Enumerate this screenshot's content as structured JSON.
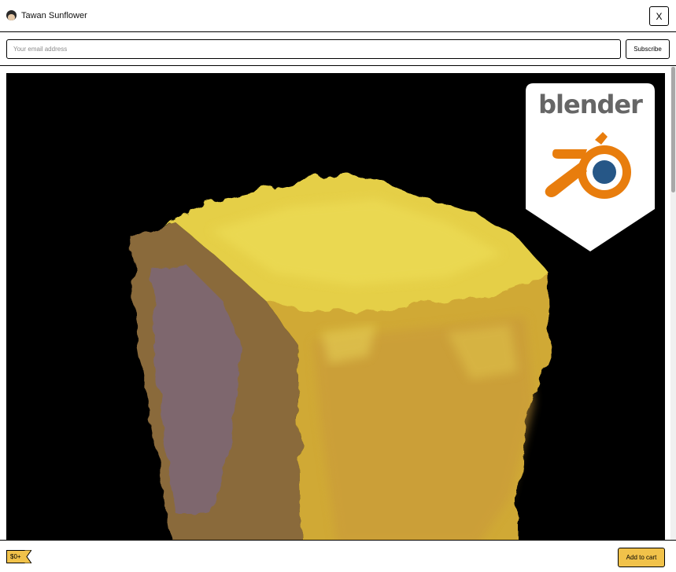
{
  "header": {
    "seller_name": "Tawan Sunflower",
    "close_label": "X"
  },
  "subscribe": {
    "email_placeholder": "Your email address",
    "button_label": "Subscribe"
  },
  "cover": {
    "badge_text": "blender",
    "badge_colors": {
      "orange": "#e87d0d",
      "blue": "#265787",
      "wordmark": "#666666"
    }
  },
  "footer": {
    "price": "$0+",
    "add_to_cart_label": "Add to cart",
    "accent_color": "#f1c24a"
  }
}
